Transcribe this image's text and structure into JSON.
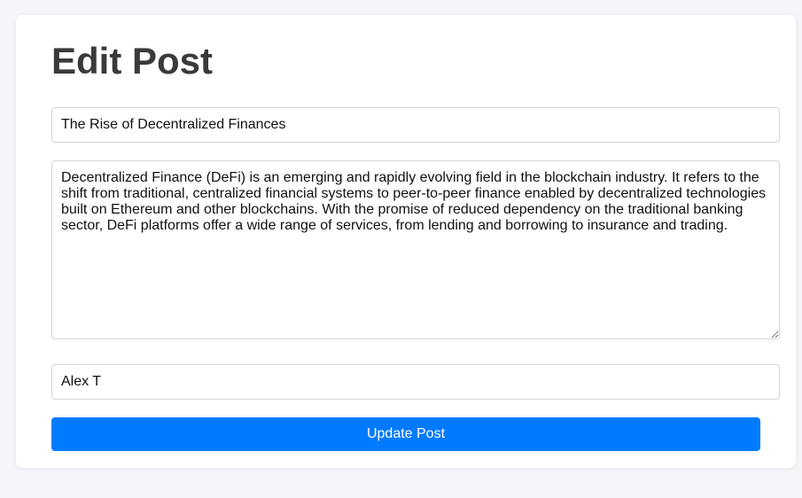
{
  "page": {
    "heading": "Edit Post"
  },
  "form": {
    "title_value": "The Rise of Decentralized Finances",
    "content_value": "Decentralized Finance (DeFi) is an emerging and rapidly evolving field in the blockchain industry. It refers to the shift from traditional, centralized financial systems to peer-to-peer finance enabled by decentralized technologies built on Ethereum and other blockchains. With the promise of reduced dependency on the traditional banking sector, DeFi platforms offer a wide range of services, from lending and borrowing to insurance and trading.",
    "author_value": "Alex T",
    "submit_label": "Update Post"
  },
  "colors": {
    "accent": "#007bff",
    "heading": "#3a3a3a",
    "background": "#f5f6fa"
  }
}
